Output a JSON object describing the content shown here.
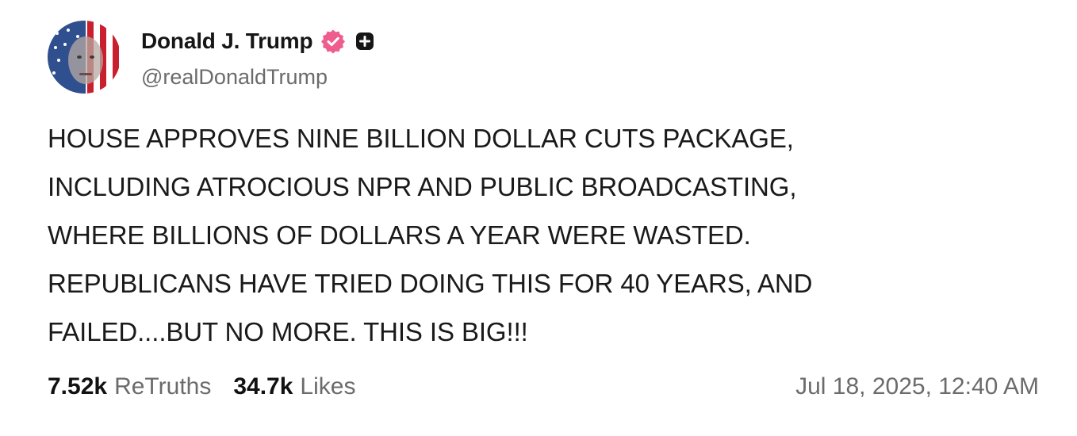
{
  "author": {
    "display_name": "Donald J. Trump",
    "handle": "@realDonaldTrump",
    "verified_badge_icon": "verified-badge-icon",
    "plus_icon": "plus-square-icon",
    "badge_color": "#ef5d8f"
  },
  "post": {
    "lines": [
      "HOUSE APPROVES NINE BILLION DOLLAR CUTS PACKAGE,",
      "INCLUDING ATROCIOUS NPR AND PUBLIC BROADCASTING,",
      "WHERE BILLIONS OF DOLLARS A YEAR WERE WASTED.",
      "REPUBLICANS HAVE TRIED DOING THIS FOR 40 YEARS, AND",
      "FAILED....BUT NO MORE. THIS IS BIG!!!"
    ]
  },
  "stats": {
    "retruths_count": "7.52k",
    "retruths_label": "ReTruths",
    "likes_count": "34.7k",
    "likes_label": "Likes"
  },
  "timestamp": "Jul 18, 2025, 12:40 AM"
}
